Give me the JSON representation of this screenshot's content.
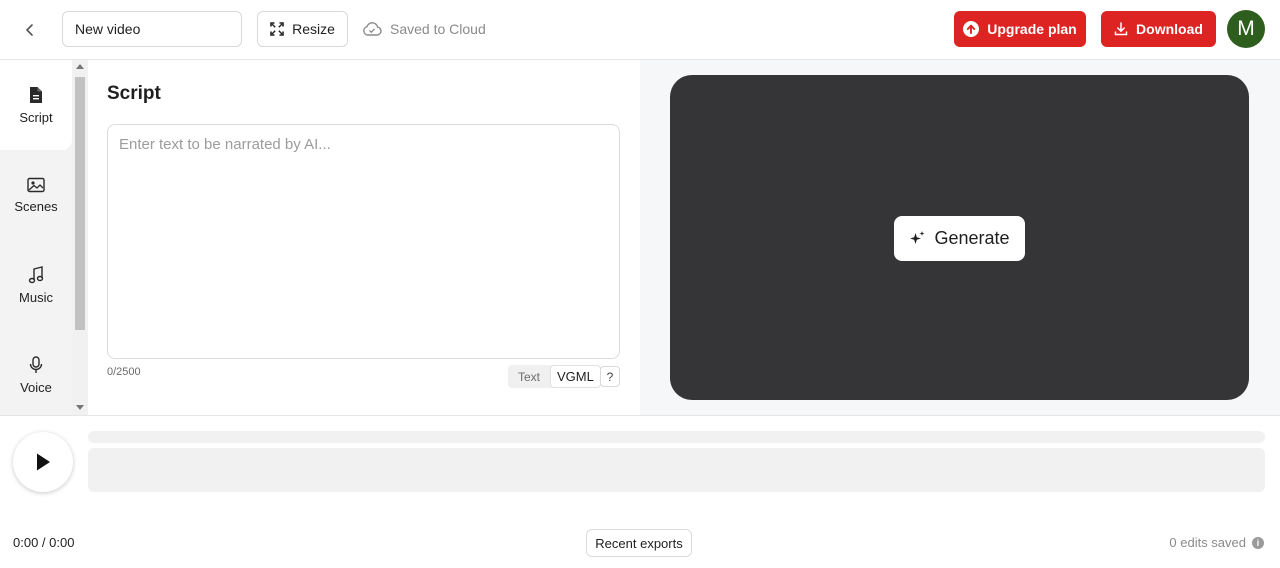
{
  "header": {
    "title_value": "New video",
    "resize_label": "Resize",
    "saved_status": "Saved to Cloud",
    "upgrade_label": "Upgrade plan",
    "download_label": "Download",
    "avatar_initial": "M"
  },
  "sidebar": {
    "items": [
      {
        "label": "Script",
        "icon": "document-icon",
        "active": true
      },
      {
        "label": "Scenes",
        "icon": "image-icon",
        "active": false
      },
      {
        "label": "Music",
        "icon": "music-note-icon",
        "active": false
      },
      {
        "label": "Voice",
        "icon": "microphone-icon",
        "active": false
      }
    ]
  },
  "script": {
    "title": "Script",
    "placeholder": "Enter text to be narrated by AI...",
    "value": "",
    "char_count": "0/2500",
    "format_options": [
      "Text",
      "VGML"
    ],
    "selected_format": "VGML",
    "help_label": "?"
  },
  "preview": {
    "generate_label": "Generate"
  },
  "timeline": {
    "time_display": "0:00 / 0:00",
    "recent_exports_label": "Recent exports",
    "edits_saved": "0 edits saved"
  },
  "colors": {
    "accent_red": "#de2323",
    "avatar_green": "#2d5e1e",
    "preview_dark": "#353537"
  }
}
